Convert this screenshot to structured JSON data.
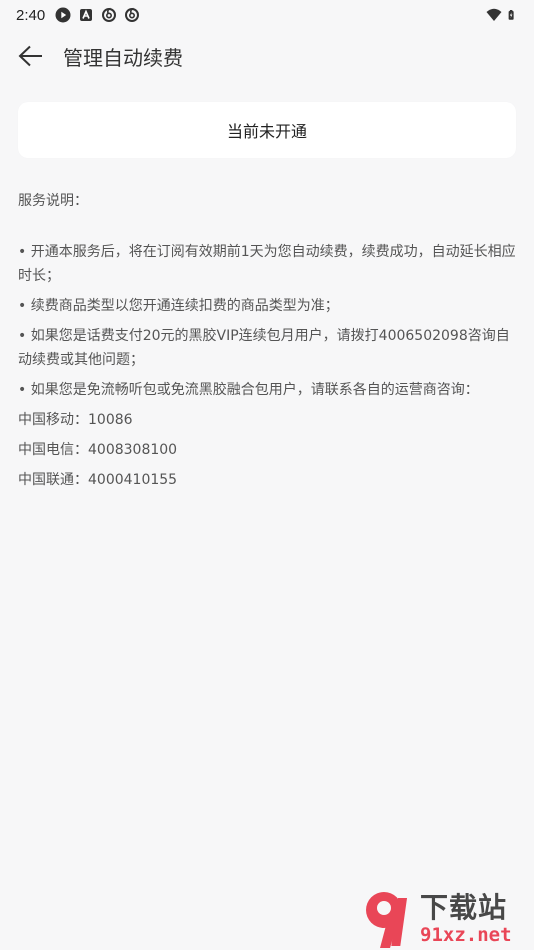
{
  "status_bar": {
    "time": "2:40"
  },
  "header": {
    "title": "管理自动续费"
  },
  "status_card": {
    "label": "当前未开通"
  },
  "service": {
    "title": "服务说明：",
    "items": [
      "• 开通本服务后，将在订阅有效期前1天为您自动续费，续费成功，自动延长相应时长；",
      "• 续费商品类型以您开通连续扣费的商品类型为准；",
      "• 如果您是话费支付20元的黑胶VIP连续包月用户，请拨打4006502098咨询自动续费或其他问题；",
      "• 如果您是免流畅听包或免流黑胶融合包用户，请联系各自的运营商咨询："
    ],
    "contacts": [
      "中国移动：10086",
      "中国电信：4008308100",
      "中国联通：4000410155"
    ]
  },
  "watermark": {
    "main": "下载站",
    "sub": "91xz.net"
  },
  "colors": {
    "background": "#f7f7f8",
    "card": "#ffffff",
    "watermark_red": "#e8384a"
  }
}
